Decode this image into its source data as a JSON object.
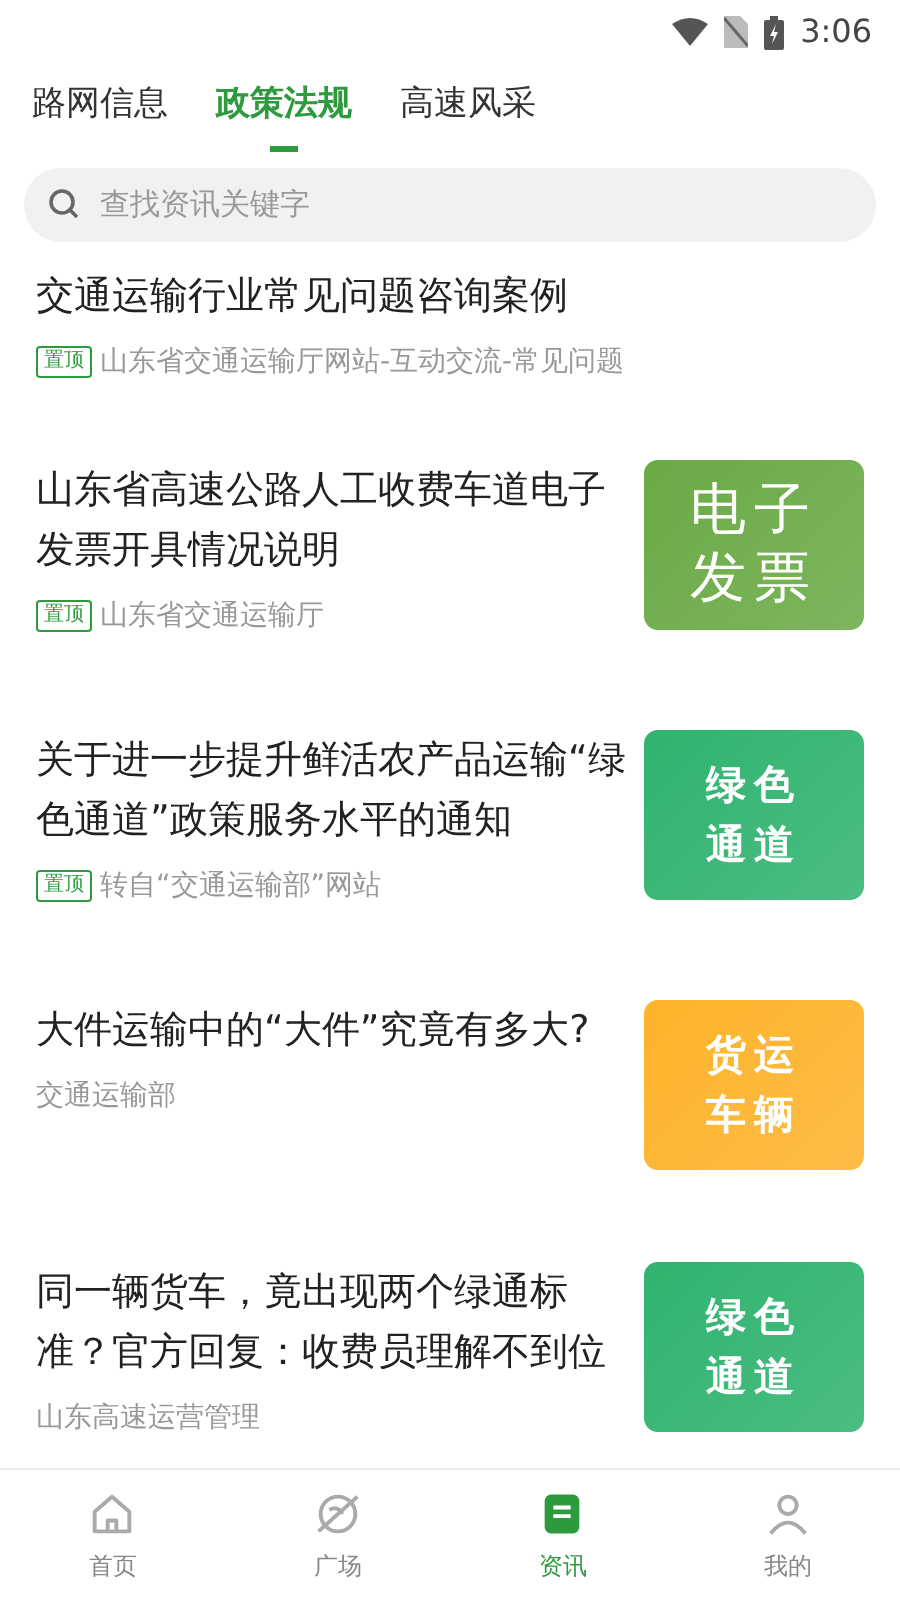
{
  "status_bar": {
    "time": "3:06"
  },
  "tabs": [
    {
      "label": "路网信息",
      "selected": false
    },
    {
      "label": "政策法规",
      "selected": true
    },
    {
      "label": "高速风采",
      "selected": false
    }
  ],
  "search": {
    "placeholder": "查找资讯关键字"
  },
  "articles": [
    {
      "title": "交通运输行业常见问题咨询案例",
      "pinned": true,
      "pin_label": "置顶",
      "source": "山东省交通运输厅网站-互动交流-常见问题"
    },
    {
      "title": "山东省高速公路人工收费车道电子发票开具情况说明",
      "pinned": true,
      "pin_label": "置顶",
      "source": "山东省交通运输厅",
      "thumb": {
        "lines": [
          "电子",
          "发票"
        ],
        "color": "#6aaa45"
      }
    },
    {
      "title": "关于进一步提升鲜活农产品运输“绿色通道”政策服务水平的通知",
      "pinned": true,
      "pin_label": "置顶",
      "source": "转自“交通运输部”网站",
      "thumb": {
        "lines": [
          "绿色",
          "通道"
        ],
        "color": "#2fb36f"
      }
    },
    {
      "title": "大件运输中的“大件”究竟有多大?",
      "pinned": false,
      "source": "交通运输部",
      "thumb": {
        "lines": [
          "货运",
          "车辆"
        ],
        "color": "#fdb32a"
      }
    },
    {
      "title": "同一辆货车，竟出现两个绿通标准？官方回复：收费员理解不到位",
      "pinned": false,
      "source": "山东高速运营管理",
      "thumb": {
        "lines": [
          "绿色",
          "通道"
        ],
        "color": "#2fb36f"
      }
    }
  ],
  "bottom_nav": [
    {
      "kind": "home",
      "label": "首页",
      "selected": false
    },
    {
      "kind": "plaza",
      "label": "广场",
      "selected": false
    },
    {
      "kind": "news",
      "label": "资讯",
      "selected": true
    },
    {
      "kind": "me",
      "label": "我的",
      "selected": false
    }
  ]
}
